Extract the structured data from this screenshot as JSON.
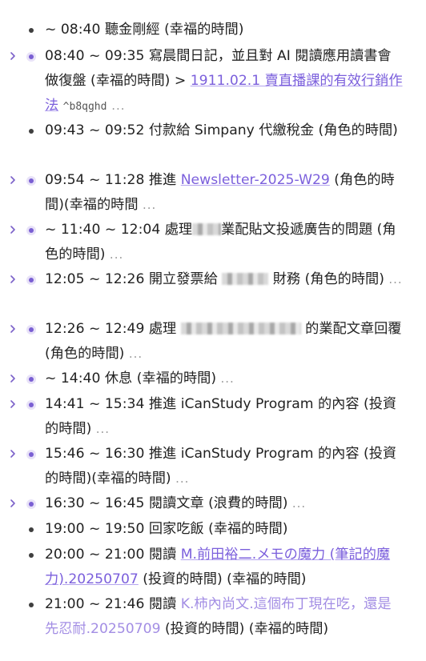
{
  "entries": [
    {
      "expandable": false,
      "parts": [
        {
          "t": "~ 08:40 聽金剛經 (幸福的時間)"
        }
      ]
    },
    {
      "expandable": true,
      "parts": [
        {
          "t": "08:40 ~ 09:35 寫晨間日記，並且對 AI 閱讀應用讀書會做復盤 (幸福的時間) > "
        },
        {
          "t": "1911.02.1 賣直播課的有效行銷作法",
          "link": true
        },
        {
          "t": " "
        },
        {
          "t": "^b8qghd",
          "ref": true
        },
        {
          "t": " ...",
          "ell": true
        }
      ]
    },
    {
      "expandable": false,
      "parts": [
        {
          "t": "09:43 ~ 09:52 付款給 Simpany 代繳稅金 (角色的時間)"
        }
      ]
    },
    {
      "expandable": true,
      "parts": [
        {
          "t": "09:54 ~ 11:28 推進 "
        },
        {
          "t": "Newsletter-2025-W29",
          "link": true
        },
        {
          "t": " (角色的時間)(幸福的時間 "
        },
        {
          "t": "...",
          "ell": true
        }
      ]
    },
    {
      "expandable": true,
      "parts": [
        {
          "t": "~ 11:40 ~ 12:04 處理"
        },
        {
          "blur": 36
        },
        {
          "t": "業配貼文投遞廣告的問題 (角色的時間) "
        },
        {
          "t": "...",
          "ell": true
        }
      ]
    },
    {
      "expandable": true,
      "parts": [
        {
          "t": "12:05 ~ 12:26 開立發票給 "
        },
        {
          "blur": 58
        },
        {
          "t": " 財務 (角色的時間) "
        },
        {
          "t": "...",
          "ell": true
        }
      ]
    },
    {
      "expandable": true,
      "parts": [
        {
          "t": "12:26 ~ 12:49 處理 "
        },
        {
          "blur": 150
        },
        {
          "t": " 的業配文章回覆 (角色的時間) "
        },
        {
          "t": "...",
          "ell": true
        }
      ]
    },
    {
      "expandable": true,
      "parts": [
        {
          "t": "~ 14:40 休息 (幸福的時間) "
        },
        {
          "t": "...",
          "ell": true
        }
      ]
    },
    {
      "expandable": true,
      "parts": [
        {
          "t": "14:41 ~ 15:34 推進 iCanStudy Program 的內容 (投資的時間) "
        },
        {
          "t": "...",
          "ell": true
        }
      ]
    },
    {
      "expandable": true,
      "parts": [
        {
          "t": "15:46 ~ 16:30 推進 iCanStudy Program 的內容 (投資的時間)(幸福的時間) "
        },
        {
          "t": "...",
          "ell": true
        }
      ]
    },
    {
      "expandable": true,
      "parts": [
        {
          "t": "16:30 ~ 16:45 閱讀文章 (浪費的時間) "
        },
        {
          "t": "...",
          "ell": true
        }
      ]
    },
    {
      "expandable": false,
      "parts": [
        {
          "t": "19:00 ~ 19:50 回家吃飯 (幸福的時間)"
        }
      ]
    },
    {
      "expandable": false,
      "parts": [
        {
          "t": "20:00 ~ 21:00 閱讀 "
        },
        {
          "t": "M.前田裕二.メモの魔力 (筆記的魔力).20250707",
          "link": true
        },
        {
          "t": " (投資的時間) (幸福的時間)"
        }
      ]
    },
    {
      "expandable": false,
      "parts": [
        {
          "t": "21:00 ~ 21:46 閱讀 "
        },
        {
          "t": "K.柿內尚文.這個布丁現在吃，還是先忍耐.20250709",
          "link2": true
        },
        {
          "t": " (投資的時間) (幸福的時間)"
        }
      ]
    }
  ]
}
